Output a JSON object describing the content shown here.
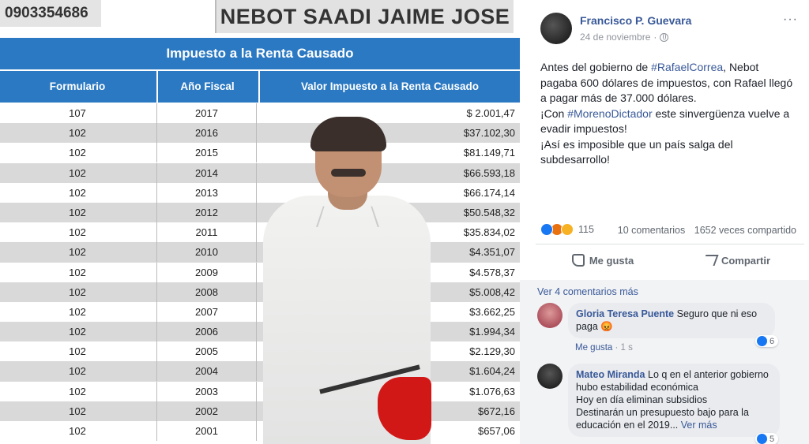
{
  "image": {
    "id_number": "0903354686",
    "person_name": "NEBOT SAADI JAIME JOSE",
    "table_title": "Impuesto a la Renta Causado",
    "columns": [
      "Formulario",
      "Año Fiscal",
      "Valor Impuesto a la Renta Causado"
    ],
    "rows": [
      {
        "form": "107",
        "year": "2017",
        "value": "$ 2.001,47"
      },
      {
        "form": "102",
        "year": "2016",
        "value": "$37.102,30"
      },
      {
        "form": "102",
        "year": "2015",
        "value": "$81.149,71"
      },
      {
        "form": "102",
        "year": "2014",
        "value": "$66.593,18"
      },
      {
        "form": "102",
        "year": "2013",
        "value": "$66.174,14"
      },
      {
        "form": "102",
        "year": "2012",
        "value": "$50.548,32"
      },
      {
        "form": "102",
        "year": "2011",
        "value": "$35.834,02"
      },
      {
        "form": "102",
        "year": "2010",
        "value": "$4.351,07"
      },
      {
        "form": "102",
        "year": "2009",
        "value": "$4.578,37"
      },
      {
        "form": "102",
        "year": "2008",
        "value": "$5.008,42"
      },
      {
        "form": "102",
        "year": "2007",
        "value": "$3.662,25"
      },
      {
        "form": "102",
        "year": "2006",
        "value": "$1.994,34"
      },
      {
        "form": "102",
        "year": "2005",
        "value": "$2.129,30"
      },
      {
        "form": "102",
        "year": "2004",
        "value": "$1.604,24"
      },
      {
        "form": "102",
        "year": "2003",
        "value": "$1.076,63"
      },
      {
        "form": "102",
        "year": "2002",
        "value": "$672,16"
      },
      {
        "form": "102",
        "year": "2001",
        "value": "$657,06"
      }
    ]
  },
  "post": {
    "author": "Francisco P. Guevara",
    "date": "24 de noviembre",
    "more": "···",
    "text_1": "Antes del gobierno de ",
    "tag_1": "#RafaelCorrea",
    "text_2": ", Nebot pagaba 600 dólares de impuestos, con Rafael llegó a pagar más de 37.000 dólares.",
    "text_3": "¡Con ",
    "tag_2": "#MorenoDictador",
    "text_4": " este sinvergüenza vuelve a evadir impuestos!",
    "text_5": "¡Así es imposible que un país salga del subdesarrollo!",
    "reaction_count": "115",
    "comments_count": "10 comentarios",
    "shares_count": "1652 veces compartido",
    "like_label": "Me gusta",
    "share_label": "Compartir"
  },
  "comments": {
    "see_more": "Ver 4 comentarios más",
    "items": [
      {
        "name": "Gloria Teresa Puente",
        "text": "Seguro que ni eso paga 😡",
        "like_label": "Me gusta",
        "time": "1 s",
        "likes": "6"
      },
      {
        "name": "Mateo Miranda",
        "text_1": "Lo q en el anterior gobierno hubo estabilidad económica",
        "text_2": "Hoy en día eliminan subsidios",
        "text_3": "Destinarán un presupuesto bajo para la educación en el 2019...",
        "see_more": "Ver más",
        "likes": "5"
      }
    ]
  },
  "colors": {
    "table_blue": "#2b79c2",
    "fb_link": "#385898",
    "fb_like": "#1877f2"
  }
}
